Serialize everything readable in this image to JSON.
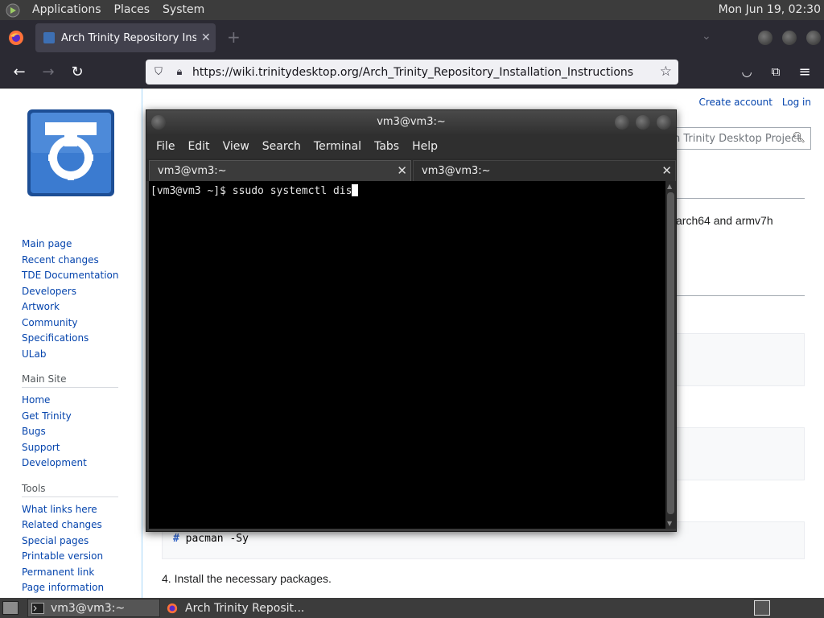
{
  "top_panel": {
    "menus": [
      "Applications",
      "Places",
      "System"
    ],
    "clock": "Mon Jun 19, 02:30"
  },
  "browser": {
    "tab_title": "Arch Trinity Repository Insta",
    "url": "https://wiki.trinitydesktop.org/Arch_Trinity_Repository_Installation_Instructions"
  },
  "wiki": {
    "personal": [
      "Create account",
      "Log in"
    ],
    "search_placeholder": "h Trinity Desktop Project",
    "nav": [
      "Main page",
      "Recent changes",
      "TDE Documentation",
      "Developers",
      "Artwork",
      "Community",
      "Specifications",
      "ULab"
    ],
    "main_site_heading": "Main Site",
    "main_site": [
      "Home",
      "Get Trinity",
      "Bugs",
      "Support",
      "Development"
    ],
    "tools_heading": "Tools",
    "tools": [
      "What links here",
      "Related changes",
      "Special pages",
      "Printable version",
      "Permanent link",
      "Page information"
    ],
    "fragment_text": "arch64 and armv7h",
    "code_hash": "#",
    "code_cmd": " pacman -Sy",
    "step_text": "4. Install the necessary packages."
  },
  "terminal": {
    "title": "vm3@vm3:~",
    "menus": [
      "File",
      "Edit",
      "View",
      "Search",
      "Terminal",
      "Tabs",
      "Help"
    ],
    "tabs": [
      "vm3@vm3:~",
      "vm3@vm3:~"
    ],
    "line": "[vm3@vm3 ~]$ ssudo systemctl dis"
  },
  "taskbar": {
    "items": [
      "vm3@vm3:~",
      "Arch Trinity Reposit..."
    ]
  }
}
